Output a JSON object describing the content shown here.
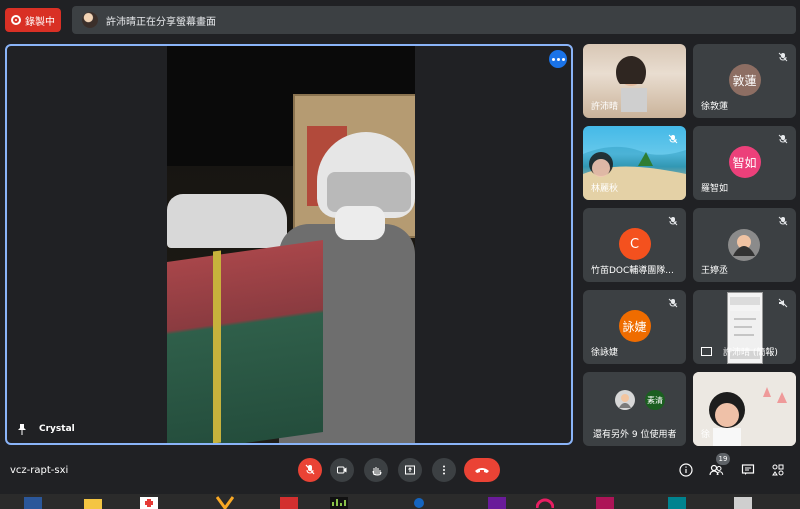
{
  "top_bar": {
    "recording_label": "錄製中",
    "share_banner_text": "許沛晴正在分享螢幕畫面"
  },
  "main_stage": {
    "speaker_name": "Crystal"
  },
  "participants": [
    {
      "name": "許沛晴",
      "type": "photo"
    },
    {
      "name": "徐敦蓮",
      "type": "avatar",
      "avatar_text": "敦蓮",
      "avatar_color": "#8d6e63"
    },
    {
      "name": "林麗秋",
      "type": "photo"
    },
    {
      "name": "羅智如",
      "type": "avatar",
      "avatar_text": "智如",
      "avatar_color": "#ec407a"
    },
    {
      "name": "竹苗DOC輔導團隊...",
      "type": "avatar",
      "avatar_text": "C",
      "avatar_color": "#f4511e"
    },
    {
      "name": "王婷丞",
      "type": "photo"
    },
    {
      "name": "徐詠婕",
      "type": "avatar",
      "avatar_text": "詠婕",
      "avatar_color": "#ef6c00"
    },
    {
      "name": "許沛晴 (簡報)",
      "type": "presentation"
    },
    {
      "name": "還有另外 9 位使用者",
      "type": "group",
      "avatar_text": "素清",
      "avatar_color": "#1b5e20"
    },
    {
      "name": "徐",
      "type": "photo"
    }
  ],
  "bottom_bar": {
    "meeting_code": "vcz-rapt-sxi",
    "participant_count": "19"
  },
  "colors": {
    "accent_blue": "#8ab4f8",
    "red": "#ea4335",
    "tile_bg": "#3c4043"
  }
}
